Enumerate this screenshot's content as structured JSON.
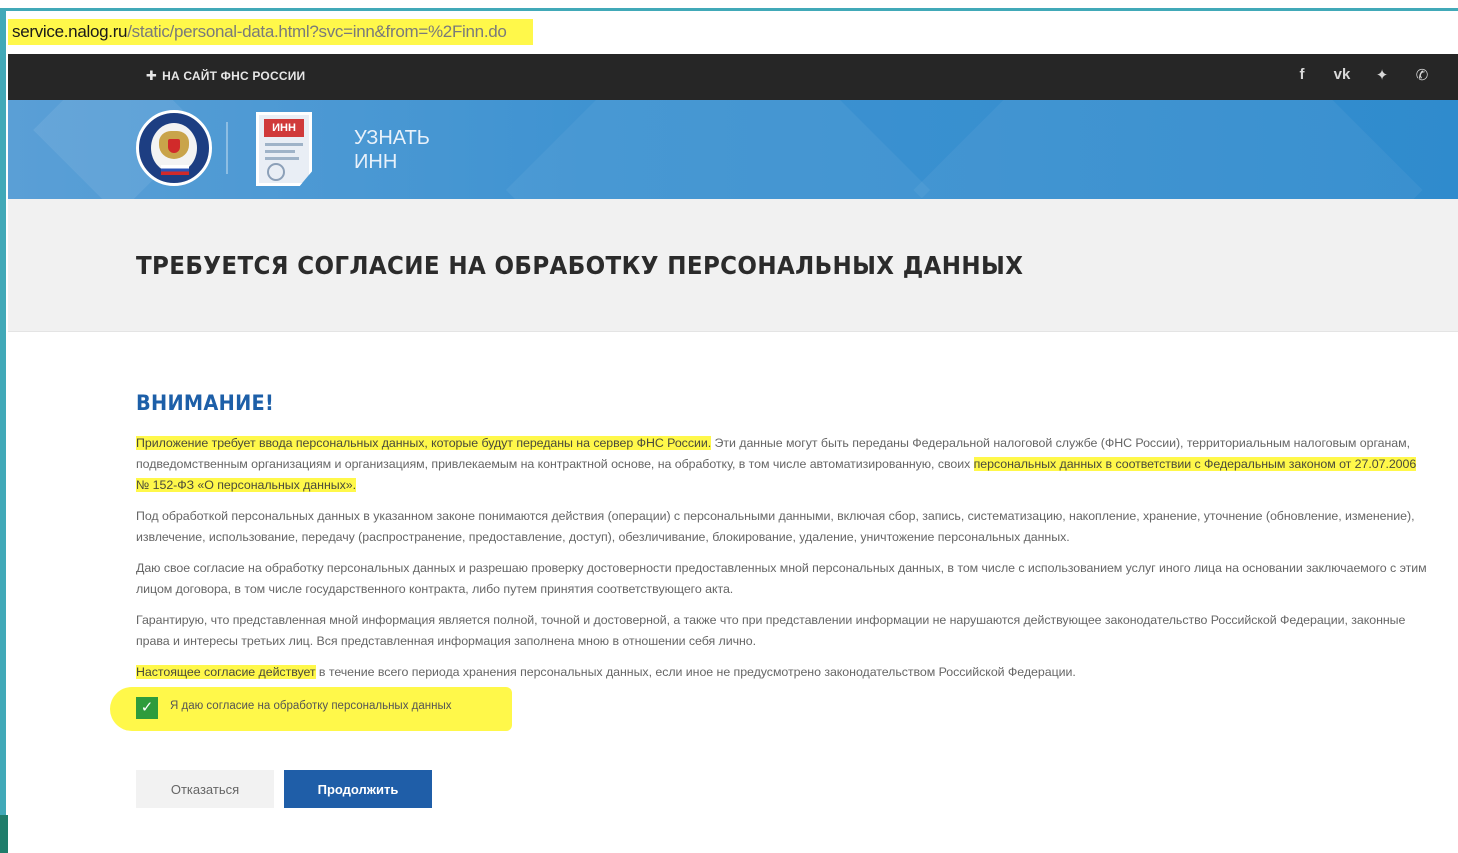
{
  "browser": {
    "url_host": "service.nalog.ru",
    "url_path": "/static/personal-data.html?svc=inn&from=%2Finn.do"
  },
  "topbar": {
    "back_link": "НА САЙТ ФНС РОССИИ",
    "social": [
      {
        "icon": "facebook-icon",
        "glyph": "f"
      },
      {
        "icon": "vk-icon",
        "glyph": "vk"
      },
      {
        "icon": "twitter-icon",
        "glyph": "✦"
      },
      {
        "icon": "phone-icon",
        "glyph": "✆"
      }
    ]
  },
  "banner": {
    "doc_badge": "ИНН",
    "service_line1": "УЗНАТЬ",
    "service_line2": "ИНН"
  },
  "page": {
    "title": "ТРЕБУЕТСЯ СОГЛАСИЕ НА ОБРАБОТКУ ПЕРСОНАЛЬНЫХ ДАННЫХ"
  },
  "content": {
    "attention": "ВНИМАНИЕ!",
    "p1_highlight": "Приложение требует ввода персональных данных, которые будут переданы на сервер ФНС России.",
    "p1_rest": " Эти данные могут быть переданы Федеральной налоговой службе (ФНС России), территориальным налоговым органам, подведомственным организациям и организациям, привлекаемым на контрактной основе, на обработку, в том числе автоматизированную, своих ",
    "p1_highlight2": "персональных данных в соответствии с Федеральным законом от 27.07.2006 № 152-ФЗ «О персональных данных».",
    "p2": "Под обработкой персональных данных в указанном законе понимаются действия (операции) с персональными данными, включая сбор, запись, систематизацию, накопление, хранение, уточнение (обновление, изменение), извлечение, использование, передачу (распространение, предоставление, доступ), обезличивание, блокирование, удаление, уничтожение персональных данных.",
    "p3": "Даю свое согласие на обработку персональных данных и разрешаю проверку достоверности предоставленных мной персональных данных, в том числе с использованием услуг иного лица на основании заключаемого с этим лицом договора, в том числе государственного контракта, либо путем принятия соответствующего акта.",
    "p4": "Гарантирую, что представленная мной информация является полной, точной и достоверной, а также что при представлении информации не нарушаются действующее законодательство Российской Федерации, законные права и интересы третьих лиц. Вся представленная информация заполнена мною в отношении себя лично.",
    "p5_highlight": "Настоящее согласие действует",
    "p5_rest": " в течение всего периода хранения персональных данных, если иное не предусмотрено законодательством Российской Федерации.",
    "consent_label": "Я даю согласие на обработку персональных данных",
    "consent_checked": true
  },
  "buttons": {
    "cancel": "Отказаться",
    "continue": "Продолжить"
  },
  "colors": {
    "highlight": "#fff84a",
    "brand_blue": "#1f5ea8",
    "banner_blue": "#2f8bcd",
    "checkbox_green": "#2e9c3c",
    "frame_teal": "#41a9b8"
  }
}
